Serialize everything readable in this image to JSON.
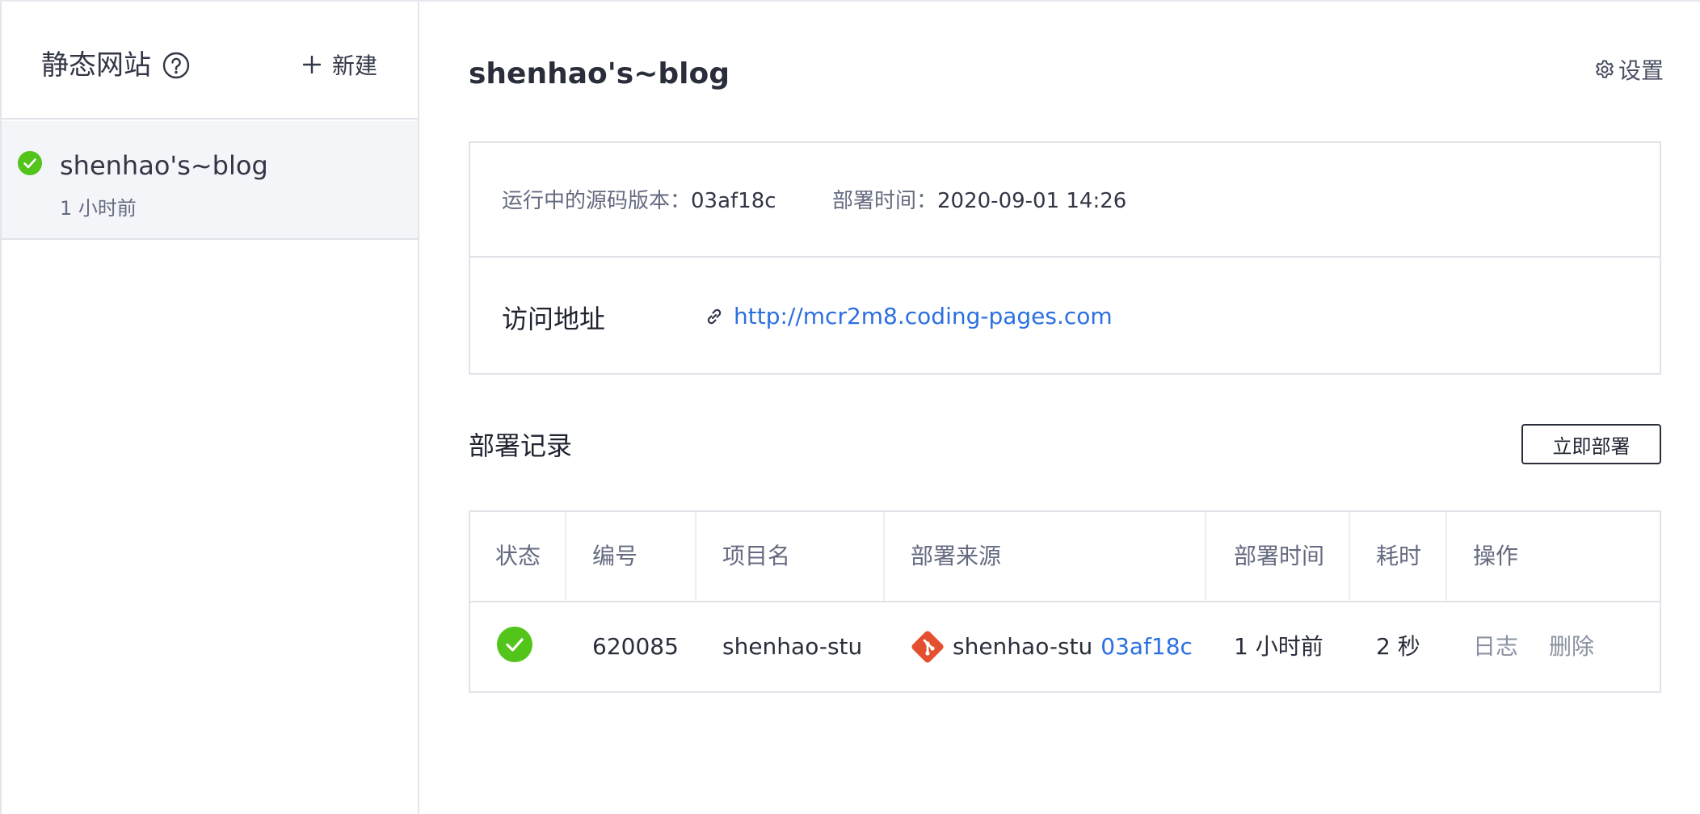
{
  "sidebar": {
    "title": "静态网站",
    "new_label": "新建",
    "items": [
      {
        "name": "shenhao's~blog",
        "time": "1 小时前",
        "status": "success"
      }
    ]
  },
  "main": {
    "title": "shenhao's~blog",
    "settings_label": "设置",
    "info": {
      "source_version_label": "运行中的源码版本：",
      "source_version": "03af18c",
      "deploy_time_label": "部署时间：",
      "deploy_time": "2020-09-01 14:26",
      "visit_label": "访问地址",
      "visit_url": "http://mcr2m8.coding-pages.com"
    },
    "records": {
      "title": "部署记录",
      "deploy_button": "立即部署",
      "columns": [
        "状态",
        "编号",
        "项目名",
        "部署来源",
        "部署时间",
        "耗时",
        "操作"
      ],
      "rows": [
        {
          "status": "success",
          "id": "620085",
          "project": "shenhao-stu",
          "source_repo": "shenhao-stu",
          "source_commit": "03af18c",
          "deploy_time": "1 小时前",
          "duration": "2 秒",
          "action_log": "日志",
          "action_delete": "删除"
        }
      ]
    }
  },
  "colors": {
    "success": "#52c41a",
    "link": "#2b6fe0",
    "git": "#e4502f",
    "border": "#dfe3e8",
    "selected_bg": "#f4f5f8"
  },
  "icons": [
    "help-circle-icon",
    "plus-icon",
    "check-circle-icon",
    "gear-icon",
    "link-icon",
    "git-icon"
  ]
}
